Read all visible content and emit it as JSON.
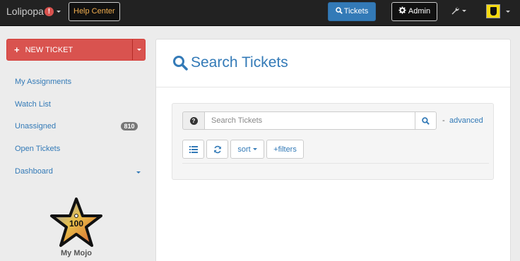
{
  "navbar": {
    "brand": "Lolipopa",
    "brand_badge": "!",
    "help_center": "Help Center",
    "tickets": "Tickets",
    "admin": "Admin"
  },
  "sidebar": {
    "new_ticket": "NEW TICKET",
    "items": [
      {
        "label": "My Assignments"
      },
      {
        "label": "Watch List"
      },
      {
        "label": "Unassigned",
        "badge": "810"
      },
      {
        "label": "Open Tickets"
      },
      {
        "label": "Dashboard"
      }
    ],
    "mojo": {
      "value": "100",
      "label": "My Mojo"
    }
  },
  "main": {
    "title": "Search Tickets",
    "search": {
      "placeholder": "Search Tickets",
      "value": ""
    },
    "help_icon": "?",
    "dash": "-",
    "advanced": "advanced",
    "toolbar": {
      "sort": "sort",
      "filters": "+filters"
    }
  },
  "colors": {
    "primary": "#337ab7",
    "danger": "#d9534f",
    "navbar": "#222222",
    "warning": "#f0ad4e"
  },
  "icons": [
    "search-icon",
    "gear-icon",
    "wrench-icon",
    "plus-icon",
    "list-icon",
    "refresh-icon",
    "question-icon",
    "avatar-ferrari-icon",
    "star-icon"
  ]
}
